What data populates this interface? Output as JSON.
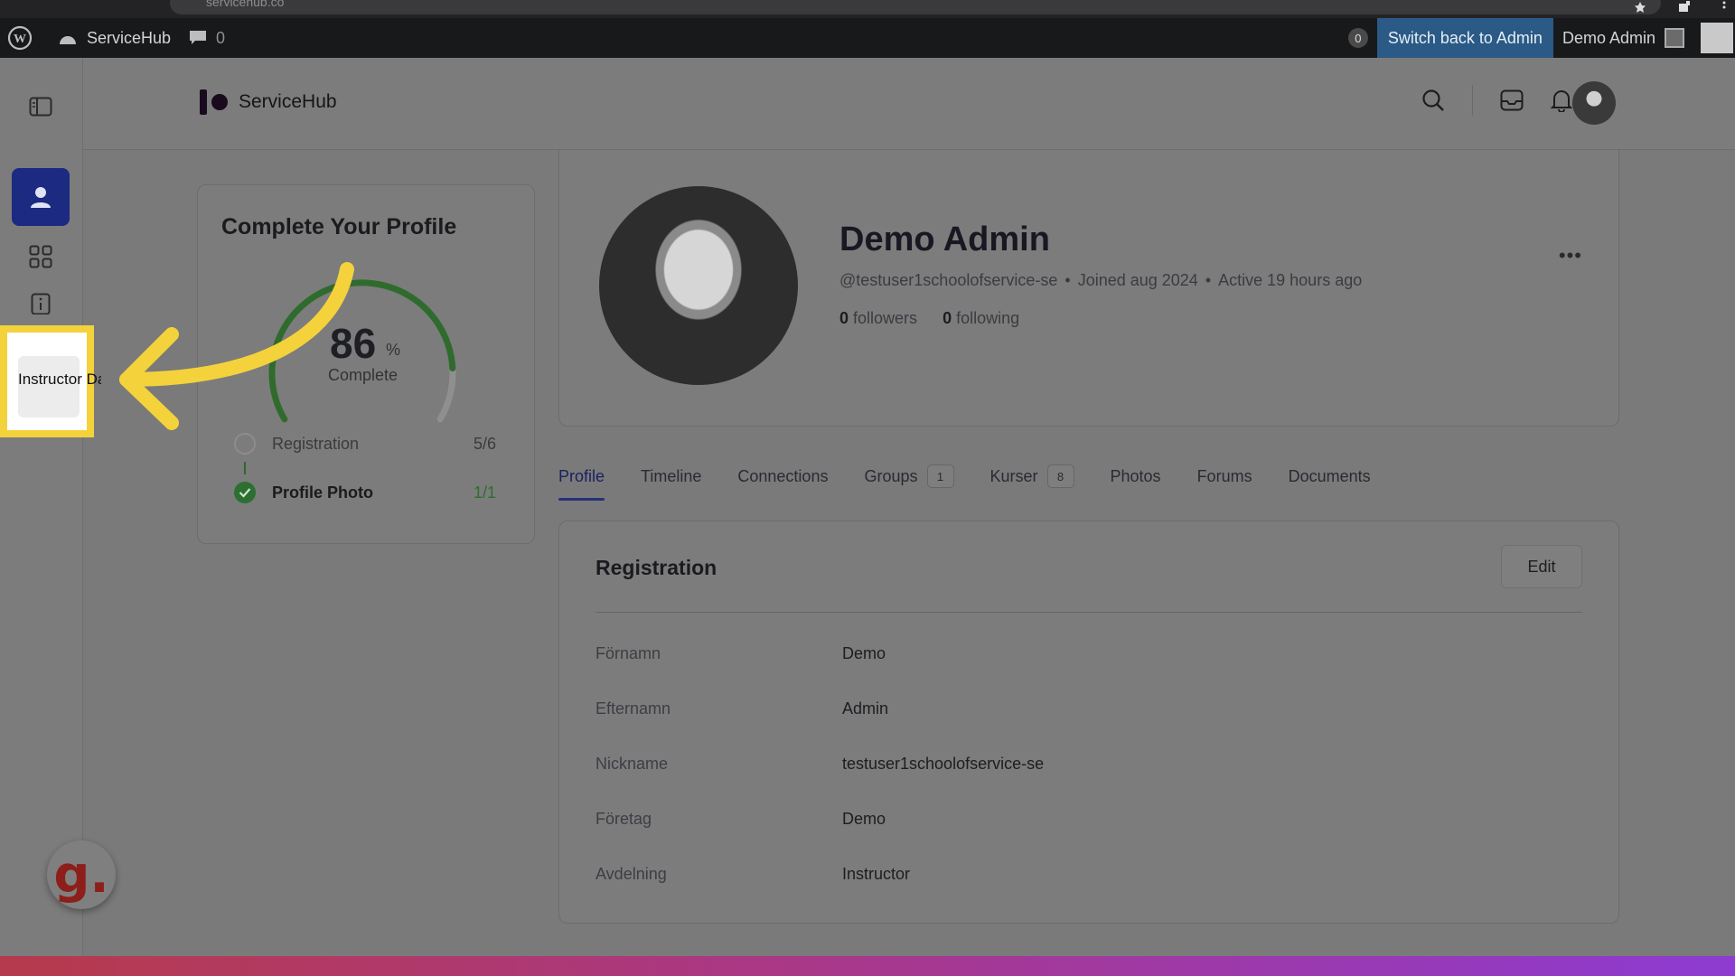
{
  "browser": {
    "url": "servicehub.co"
  },
  "adminbar": {
    "site_name": "ServiceHub",
    "comments_count": "0",
    "updates_count": "0",
    "switch_back": "Switch back to Admin",
    "user_name": "Demo Admin"
  },
  "header": {
    "logo_text": "ServiceHub"
  },
  "highlight": {
    "label": "Instructor Dashboard"
  },
  "complete_profile": {
    "title": "Complete Your Profile",
    "percent": 86,
    "percent_sign": "%",
    "complete_label": "Complete",
    "steps": [
      {
        "label": "Registration",
        "count": "5/6",
        "done": false
      },
      {
        "label": "Profile Photo",
        "count": "1/1",
        "done": true
      }
    ]
  },
  "profile": {
    "name": "Demo Admin",
    "handle": "@testuser1schoolofservice-se",
    "sep": "•",
    "joined": "Joined aug 2024",
    "active": "Active 19 hours ago",
    "followers_count": "0",
    "followers_label": "followers",
    "following_count": "0",
    "following_label": "following",
    "more": "•••"
  },
  "tabs": [
    {
      "label": "Profile",
      "active": true
    },
    {
      "label": "Timeline"
    },
    {
      "label": "Connections"
    },
    {
      "label": "Groups",
      "badge": "1"
    },
    {
      "label": "Kurser",
      "badge": "8"
    },
    {
      "label": "Photos"
    },
    {
      "label": "Forums"
    },
    {
      "label": "Documents"
    }
  ],
  "registration": {
    "title": "Registration",
    "edit_label": "Edit",
    "fields": [
      {
        "key": "Förnamn",
        "value": "Demo"
      },
      {
        "key": "Efternamn",
        "value": "Admin"
      },
      {
        "key": "Nickname",
        "value": "testuser1schoolofservice-se"
      },
      {
        "key": "Företag",
        "value": "Demo"
      },
      {
        "key": "Avdelning",
        "value": "Instructor"
      }
    ]
  },
  "gbot": {
    "glyph": "g."
  },
  "colors": {
    "accent": "#1c2a82",
    "highlight": "#f4d23b",
    "success": "#2e7d32"
  }
}
